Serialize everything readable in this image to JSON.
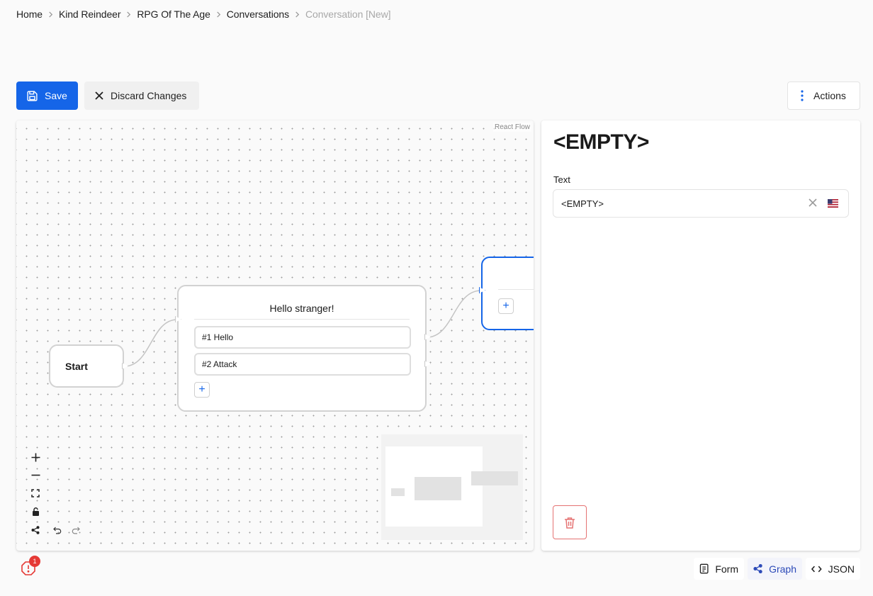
{
  "breadcrumb": [
    {
      "label": "Home"
    },
    {
      "label": "Kind Reindeer"
    },
    {
      "label": "RPG Of The Age"
    },
    {
      "label": "Conversations"
    },
    {
      "label": "Conversation [New]"
    }
  ],
  "toolbar": {
    "save_label": "Save",
    "discard_label": "Discard Changes",
    "actions_label": "Actions"
  },
  "canvas": {
    "attribution": "React Flow",
    "nodes": {
      "start": {
        "label": "Start"
      },
      "hello": {
        "title": "Hello stranger!",
        "options": [
          {
            "label": "#1 Hello"
          },
          {
            "label": "#2 Attack"
          }
        ]
      },
      "empty": {
        "title": ""
      }
    },
    "add_label": "+"
  },
  "panel": {
    "title": "<EMPTY>",
    "text_label": "Text",
    "text_value": "<EMPTY>"
  },
  "footer": {
    "issues_count": "1",
    "tabs": {
      "form": "Form",
      "graph": "Graph",
      "json": "JSON"
    },
    "active_tab": "graph"
  },
  "colors": {
    "primary": "#1565e8",
    "danger": "#e57373",
    "badge": "#e53935",
    "graph_tab": "#2c4ab8"
  }
}
